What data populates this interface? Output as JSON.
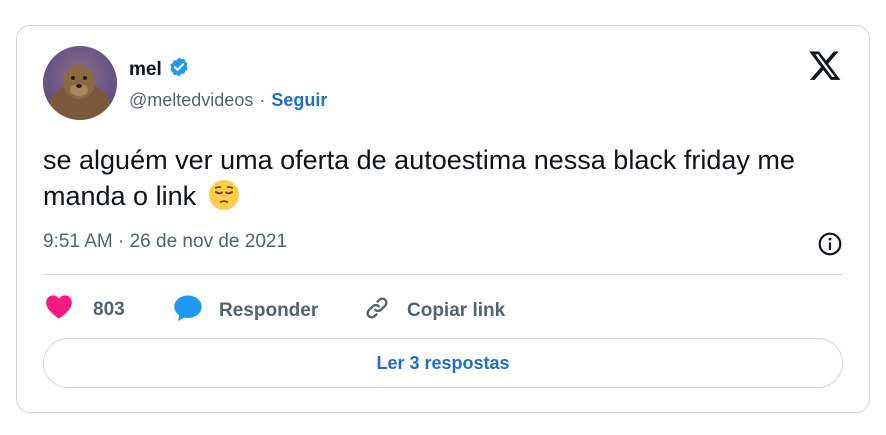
{
  "tweet": {
    "author_name": "mel",
    "handle": "@meltedvideos",
    "separator": "·",
    "follow_label": "Seguir",
    "text": "se alguém ver uma oferta de autoestima nessa black friday me manda o link",
    "emoji": "pensive-face-emoji",
    "time": "9:51 AM",
    "date": "26 de nov de 2021",
    "likes": "803",
    "reply_label": "Responder",
    "copy_link_label": "Copiar link",
    "read_replies_label": "Ler 3 respostas"
  },
  "icons": {
    "verified": "verified-badge-icon",
    "logo": "x-logo-icon",
    "info": "info-icon",
    "like": "heart-icon",
    "reply": "speech-bubble-icon",
    "link": "link-icon"
  },
  "colors": {
    "accent": "#1d6fc8",
    "verified": "#1d9bf0",
    "heart": "#f91880",
    "reply_bubble": "#1d9bf0",
    "text_secondary": "#536471",
    "border": "#cfd9de"
  }
}
